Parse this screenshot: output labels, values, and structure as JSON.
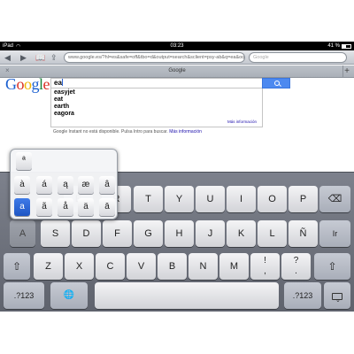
{
  "status_bar": {
    "device": "iPad",
    "time": "03:23",
    "battery": "41 %"
  },
  "toolbar": {
    "url": "www.google.es/?hl=es&safe=off&tbo=d&output=search&sclient=psy-ab&q=ea&oq=ea&gs_l=X...",
    "search_placeholder": "Google"
  },
  "tab_bar": {
    "title": "Google",
    "close_icon": "close-icon",
    "new_tab_icon": "plus-icon"
  },
  "google": {
    "logo_letters": [
      "G",
      "o",
      "o",
      "g",
      "l",
      "e"
    ],
    "query": "ea",
    "suggestions": [
      "easyjet",
      "eat",
      "earth",
      "eagora"
    ],
    "more_info": "Más información",
    "instant_text": "Google Instant no está disponible. Pulsa Intro para buscar.",
    "instant_link": "Más información"
  },
  "accent_popup": {
    "row1": [
      "ª"
    ],
    "row2": [
      "à",
      "á",
      "ą",
      "æ",
      "â"
    ],
    "row3": [
      "a",
      "ã",
      "å",
      "ä",
      "ā"
    ]
  },
  "keyboard": {
    "row1": [
      "Q",
      "W",
      "E",
      "R",
      "T",
      "Y",
      "U",
      "I",
      "O",
      "P"
    ],
    "row2": [
      "A",
      "S",
      "D",
      "F",
      "G",
      "H",
      "J",
      "K",
      "L",
      "Ñ"
    ],
    "row3": [
      "Z",
      "X",
      "C",
      "V",
      "B",
      "N",
      "M"
    ],
    "punct1": [
      "!",
      ","
    ],
    "punct2": [
      "?",
      "."
    ],
    "backspace": "⌫",
    "go": "Ir",
    "shift": "⇧",
    "numbers": ".?123",
    "globe": "🌐",
    "hide": "⌨"
  },
  "colors": {
    "accent_blue": "#2a62d6",
    "google_button": "#4c89f0",
    "link": "#1a0dab"
  }
}
